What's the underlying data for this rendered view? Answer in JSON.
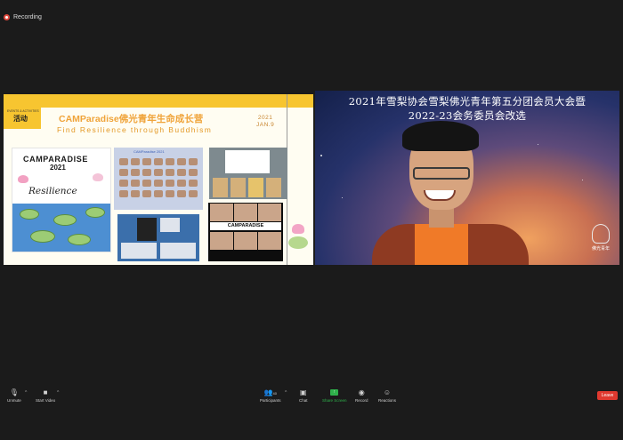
{
  "recording": {
    "label": "Recording"
  },
  "slide": {
    "tag_small": "EVENTS & ACTIVITIES",
    "tag_big": "活动",
    "title": "CAMParadise佛光青年生命成长营",
    "subtitle": "Find Resilience through Buddhism",
    "year": "2021",
    "date": "JAN.9",
    "poster": {
      "title": "CAMPARADISE",
      "year": "2021",
      "word": "Resilience"
    },
    "grid_caption": "CAMParadise 2021",
    "camp_word": "CAMPARADISE"
  },
  "camera": {
    "caption_line1": "2021年雪梨协会雪梨佛光青年第五分团会员大会暨",
    "caption_line2": "2022-23会务委员会改选",
    "logo_text": "佛光青年"
  },
  "toolbar": {
    "unmute": "Unmute",
    "start_video": "Start Video",
    "participants": "Participants",
    "participants_count": "40",
    "chat": "Chat",
    "share_screen": "Share Screen",
    "record": "Record",
    "reactions": "Reactions",
    "leave": "Leave"
  },
  "colors": {
    "slide_yellow": "#f7c530",
    "title_orange": "#f0a43a",
    "share_green": "#2fb24b",
    "leave_red": "#e0392f",
    "recording_red": "#e0483d"
  }
}
